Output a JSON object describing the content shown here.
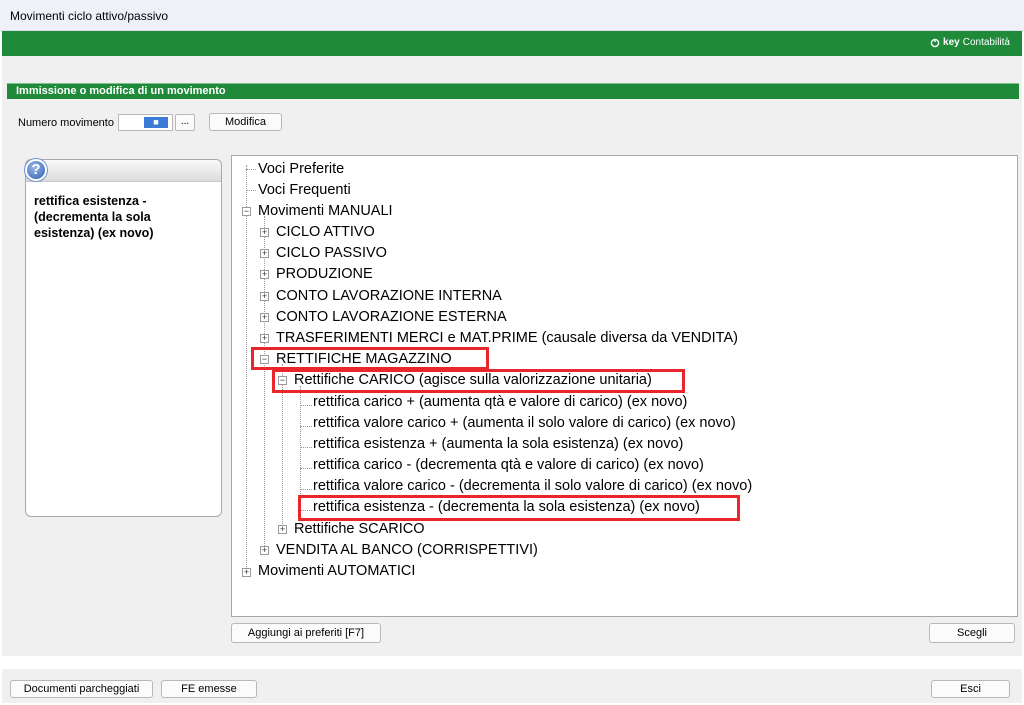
{
  "window": {
    "title": "Movimenti ciclo attivo/passivo"
  },
  "brand": {
    "part1": "key",
    "part2": "Contabilità"
  },
  "section": {
    "title": "Immissione o modifica di un movimento"
  },
  "form": {
    "numero_label": "Numero movimento",
    "numero_value": "■",
    "lookup_label": "...",
    "modifica_label": "Modifica"
  },
  "help": {
    "icon": "?",
    "text": "rettifica esistenza - (decrementa la sola esistenza) (ex novo)"
  },
  "tree": {
    "n0": "Voci Preferite",
    "n1": "Voci Frequenti",
    "n2": "Movimenti MANUALI",
    "n3": "CICLO ATTIVO",
    "n4": "CICLO PASSIVO",
    "n5": "PRODUZIONE",
    "n6": "CONTO LAVORAZIONE INTERNA",
    "n7": "CONTO LAVORAZIONE ESTERNA",
    "n8": "TRASFERIMENTI MERCI e MAT.PRIME (causale diversa da VENDITA)",
    "n9": "RETTIFICHE MAGAZZINO",
    "n10": "Rettifiche CARICO (agisce sulla valorizzazione unitaria)",
    "n11": "rettifica carico + (aumenta qtà e valore di carico) (ex novo)",
    "n12": "rettifica valore carico + (aumenta il solo valore di carico) (ex novo)",
    "n13": "rettifica esistenza + (aumenta la sola esistenza) (ex novo)",
    "n14": "rettifica carico - (decrementa qtà e valore di carico) (ex novo)",
    "n15": "rettifica valore carico - (decrementa il solo valore di carico) (ex novo)",
    "n16": "rettifica esistenza - (decrementa la sola esistenza) (ex novo)",
    "n17": "Rettifiche SCARICO",
    "n18": "VENDITA AL BANCO (CORRISPETTIVI)",
    "n19": "Movimenti AUTOMATICI",
    "expand": "+",
    "collapse": "−"
  },
  "buttons": {
    "aggiungi": "Aggiungi ai preferiti [F7]",
    "scegli": "Scegli",
    "documenti": "Documenti parcheggiati",
    "fe": "FE emesse",
    "esci": "Esci"
  },
  "colors": {
    "accent_green": "#1f8a3a",
    "highlight_red": "#e8262b",
    "help_blue": "#2d5fb0"
  },
  "icons": {
    "brand": "key-logo-icon",
    "help": "question-icon"
  }
}
